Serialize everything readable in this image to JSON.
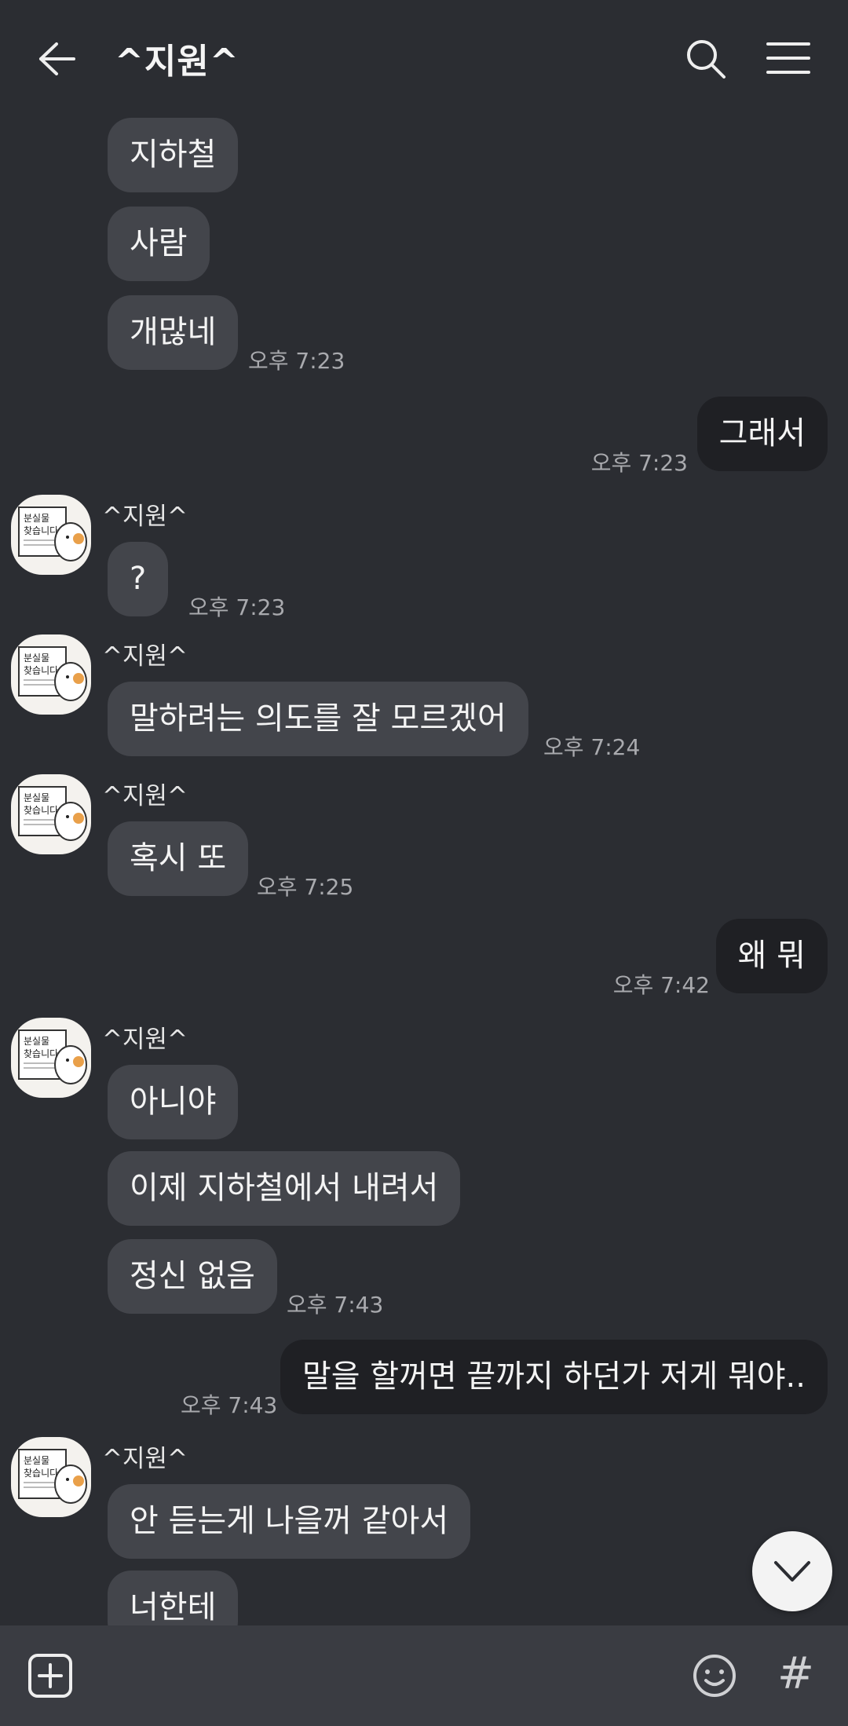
{
  "header": {
    "title": "^지원^",
    "back_icon": "arrow-left-icon",
    "search_icon": "search-icon",
    "menu_icon": "hamburger-menu-icon"
  },
  "messages": [
    {
      "from": "other",
      "text": "지하철"
    },
    {
      "from": "other",
      "text": "사람"
    },
    {
      "from": "other",
      "text": "개많네",
      "time": "오후 7:23"
    },
    {
      "from": "me",
      "text": "그래서",
      "time": "오후 7:23"
    },
    {
      "from": "other",
      "sender": "^지원^",
      "text": "?",
      "time": "오후 7:23"
    },
    {
      "from": "other",
      "sender": "^지원^",
      "text": "말하려는 의도를 잘 모르겠어",
      "time": "오후 7:24"
    },
    {
      "from": "other",
      "sender": "^지원^",
      "text": "혹시 또",
      "time": "오후 7:25"
    },
    {
      "from": "me",
      "text": "왜 뭐",
      "time": "오후 7:42"
    },
    {
      "from": "other",
      "sender": "^지원^",
      "text": "아니야"
    },
    {
      "from": "other",
      "text": "이제 지하철에서 내려서"
    },
    {
      "from": "other",
      "text": "정신 없음",
      "time": "오후 7:43"
    },
    {
      "from": "me",
      "text": "말을 할꺼면 끝까지 하던가 저게 뭐야..",
      "time": "오후 7:43"
    },
    {
      "from": "other",
      "sender": "^지원^",
      "text": "안 듣는게 나을꺼 같아서"
    },
    {
      "from": "other",
      "text": "너한테"
    }
  ],
  "input_bar": {
    "add_icon": "plus-square-icon",
    "emoji_icon": "emoji-smile-icon",
    "hash_label": "#"
  },
  "scroll_button_icon": "chevron-down-icon",
  "colors": {
    "background": "#2b2d32",
    "bubble_other": "#43454b",
    "bubble_me": "#1f2024",
    "input_bar": "#3a3c42"
  }
}
